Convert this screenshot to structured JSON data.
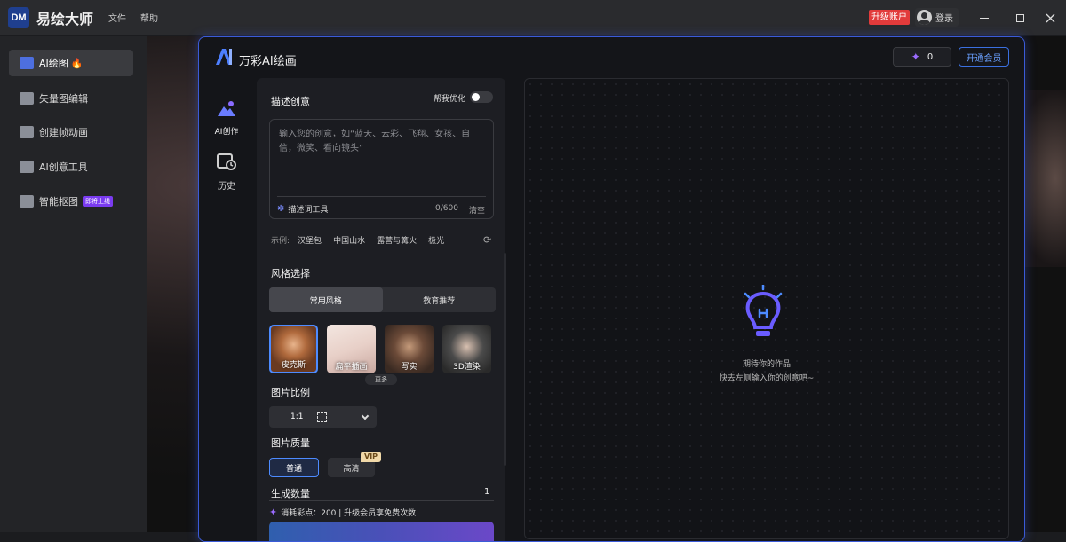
{
  "titlebar": {
    "logo_text": "DM",
    "app_name": "易绘大师",
    "menu": [
      "文件",
      "帮助"
    ],
    "upgrade_label": "升级账户",
    "login_label": "登录",
    "window_controls": [
      "minimize-icon",
      "maximize-icon",
      "close-icon"
    ]
  },
  "sidebar": {
    "items": [
      {
        "label": "AI绘图",
        "icon": "image-icon",
        "active": true,
        "badge": "fire-icon"
      },
      {
        "label": "矢量图编辑",
        "icon": "vector-icon"
      },
      {
        "label": "创建帧动画",
        "icon": "animation-icon"
      },
      {
        "label": "AI创意工具",
        "icon": "ai-tool-icon"
      },
      {
        "label": "智能抠图",
        "icon": "cutout-icon",
        "badge_text": "即将上线"
      }
    ]
  },
  "panel": {
    "brand_name": "万彩AI绘画",
    "points": "0",
    "vip_label": "开通会员",
    "nav": [
      {
        "label": "AI创作",
        "icon": "ai-create-icon"
      },
      {
        "label": "历史",
        "icon": "history-icon"
      }
    ]
  },
  "form": {
    "describe_label": "描述创意",
    "optimize_label": "帮我优化",
    "optimize_on": false,
    "prompt_placeholder": "输入您的创意，如“蓝天、云彩、飞翔、女孩、自信，微笑、看向镜头”",
    "tool_label": "描述词工具",
    "char_count": "0/600",
    "clear_label": "清空",
    "examples_label": "示例:",
    "examples": [
      "汉堡包",
      "中国山水",
      "露营与篝火",
      "极光"
    ],
    "style_label": "风格选择",
    "style_tabs": [
      "常用风格",
      "教育推荐"
    ],
    "styles": [
      "皮克斯",
      "扁平插画",
      "写实",
      "3D渲染"
    ],
    "more_label": "更多",
    "ratio_label": "图片比例",
    "ratio_value": "1:1",
    "quality_label": "图片质量",
    "quality_options": [
      "普通",
      "高清"
    ],
    "vip_tag": "VIP",
    "count_label": "生成数量",
    "count_value": "1",
    "cost_text": "消耗彩点：200 | 升级会员享免费次数"
  },
  "result": {
    "line1": "期待你的作品",
    "line2": "快去左侧输入你的创意吧~"
  },
  "colors": {
    "accent": "#4d8bff",
    "panel_border": "#3b5bd8",
    "upgrade": "#e23b3b",
    "badge_purple": "#7a3bf0"
  }
}
